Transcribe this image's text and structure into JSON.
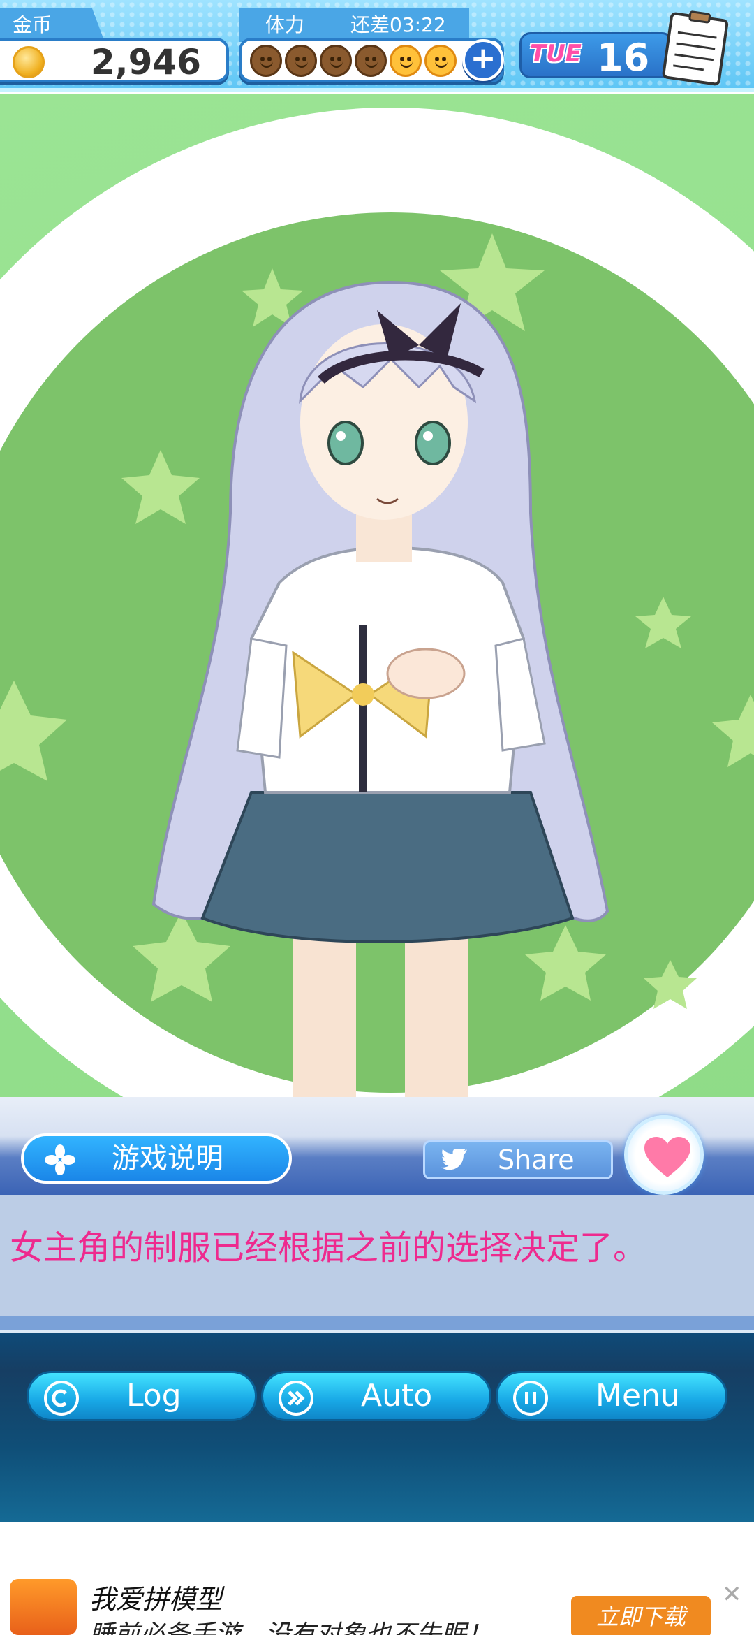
{
  "hud": {
    "coins_label": "金币",
    "coins_value": "2,946",
    "stamina_label": "体力",
    "stamina_timer": "还差03:22",
    "stamina_used": 4,
    "stamina_total": 6,
    "day": "TUE",
    "date": "16"
  },
  "actions": {
    "howto_label": "游戏说明",
    "share_label": "Share"
  },
  "dialog": {
    "text": "女主角的制服已经根据之前的选择决定了。"
  },
  "nav": {
    "log_label": "Log",
    "auto_label": "Auto",
    "menu_label": "Menu"
  },
  "ad": {
    "title": "我爱拼模型",
    "subtitle": "睡前必备手游，没有对象也不失眠！",
    "cta": "立即下载",
    "close": "✕"
  },
  "colors": {
    "hud_blue": "#4aa6e6",
    "scene_green": "#7dc36a",
    "dialog_text": "#ee2a8e",
    "nav_cyan": "#18a8e6",
    "ad_orange": "#f08a20"
  },
  "icons": {
    "coin": "coin-icon",
    "stamina": "smiley-face-icon",
    "add": "plus-icon",
    "calendar": "calendar-note-icon",
    "howto": "clover-icon",
    "share": "twitter-bird-icon",
    "favorite": "heart-icon",
    "log": "copyright-c-icon",
    "auto": "fast-forward-icon",
    "menu": "pause-icon"
  }
}
